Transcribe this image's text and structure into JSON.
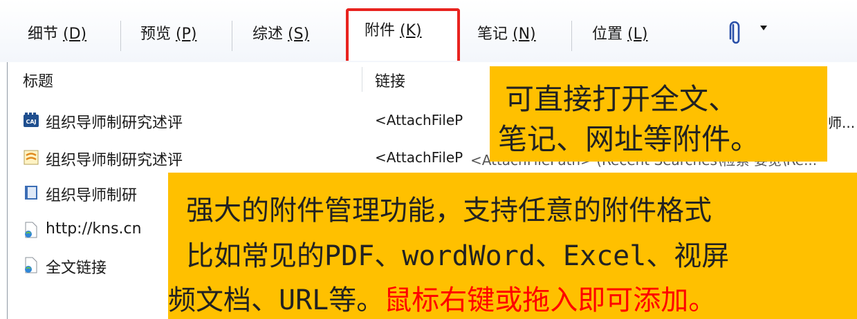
{
  "tabs": [
    {
      "label": "细节",
      "key": "(D)"
    },
    {
      "label": "预览",
      "key": "(P)"
    },
    {
      "label": "综述",
      "key": "(S)"
    },
    {
      "label": "附件",
      "key": "(K)"
    },
    {
      "label": "笔记",
      "key": "(N)"
    },
    {
      "label": "位置",
      "key": "(L)"
    }
  ],
  "active_tab": "附件 (K)",
  "columns": {
    "title": "标题",
    "link": "链接"
  },
  "rows": [
    {
      "title": "组织导师制研究述评",
      "link": "<AttachFileP",
      "icon": "caj-file-icon"
    },
    {
      "title": "组织导师制研究述评",
      "link": "<AttachFileP",
      "icon": "note-file-icon"
    },
    {
      "title": "组织导师制研",
      "link": "",
      "icon": "notebook-file-icon"
    },
    {
      "title": "http://kns.cn",
      "link": "",
      "icon": "web-link-icon"
    },
    {
      "title": "全文链接",
      "link": "",
      "icon": "web-link-icon"
    }
  ],
  "row2_link_tail": "<AttachFilePath> (Recent Searches\\检索 要览\\Re...",
  "row1_link_tail": "师...",
  "callout_top": {
    "line1": "可直接打开全文、",
    "line2": "笔记、网址等附件。"
  },
  "callout_bottom": {
    "line1": "强大的附件管理功能，支持任意的附件格式",
    "line2": "比如常见的PDF、wordWord、Excel、视屏",
    "line3_prefix": "频文档、URL等。",
    "line3_highlight": "鼠标右键或拖入即可添加。"
  },
  "colors": {
    "highlight_border": "#e8231f",
    "callout_bg": "#ffc000",
    "emphasis_text": "#ff0000"
  }
}
